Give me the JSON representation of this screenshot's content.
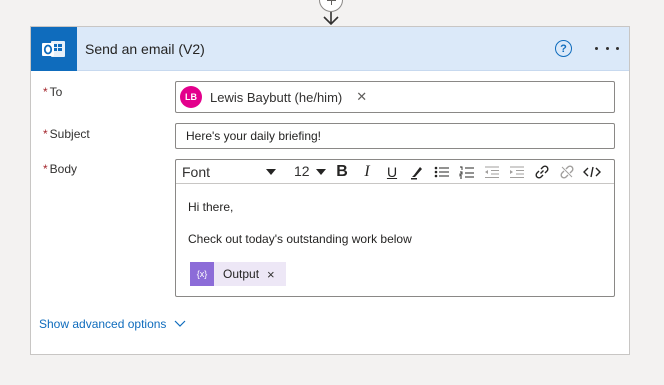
{
  "card": {
    "title": "Send an email (V2)",
    "help_glyph": "?",
    "app_icon": "outlook-icon"
  },
  "fields": {
    "to": {
      "label": "To",
      "required_mark": "*",
      "token": {
        "initials": "LB",
        "name": "Lewis Baybutt (he/him)",
        "remove_glyph": "✕",
        "avatar_color": "#e3008c"
      }
    },
    "subject": {
      "label": "Subject",
      "required_mark": "*",
      "value": "Here's your daily briefing!"
    },
    "body": {
      "label": "Body",
      "required_mark": "*",
      "toolbar": {
        "font": "Font",
        "size": "12",
        "bold": "B",
        "italic": "I",
        "underline": "U"
      },
      "lines": [
        "Hi there,",
        "Check out today's outstanding work below"
      ],
      "dynamic_token": {
        "icon_text": "{x}",
        "label": "Output",
        "remove_glyph": "×"
      }
    }
  },
  "advanced_options": {
    "label": "Show advanced options"
  },
  "colors": {
    "accent": "#0f6cbd",
    "header_bg": "#dbe9f9",
    "required": "#a4262c",
    "token_bg": "#ede7f6",
    "token_icon": "#8c6cd8"
  }
}
